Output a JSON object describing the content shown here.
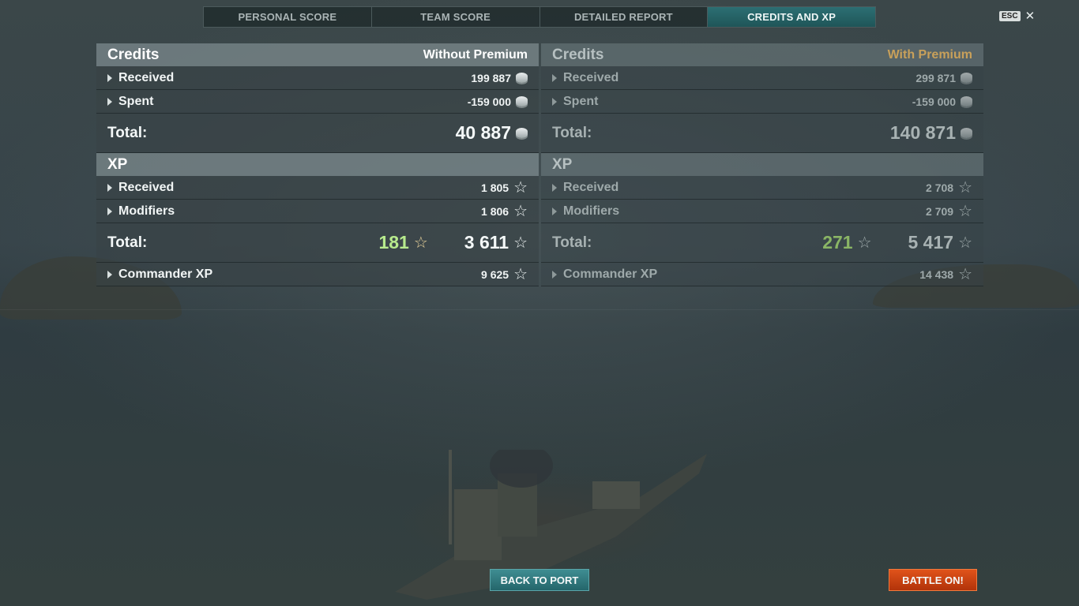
{
  "tabs": [
    {
      "label": "PERSONAL SCORE",
      "active": false
    },
    {
      "label": "TEAM SCORE",
      "active": false
    },
    {
      "label": "DETAILED REPORT",
      "active": false
    },
    {
      "label": "CREDITS AND XP",
      "active": true
    }
  ],
  "esc": {
    "key": "ESC",
    "close_icon": "close-icon"
  },
  "without_premium": {
    "credits": {
      "title": "Credits",
      "column_label": "Without Premium",
      "received": {
        "label": "Received",
        "value": "199 887"
      },
      "spent": {
        "label": "Spent",
        "value": "-159 000"
      },
      "total": {
        "label": "Total:",
        "value": "40 887"
      }
    },
    "xp": {
      "title": "XP",
      "received": {
        "label": "Received",
        "value": "1 805"
      },
      "modifiers": {
        "label": "Modifiers",
        "value": "1 806"
      },
      "total": {
        "label": "Total:",
        "free_xp": "181",
        "value": "3 611"
      },
      "commander": {
        "label": "Commander XP",
        "value": "9 625"
      }
    }
  },
  "with_premium": {
    "credits": {
      "title": "Credits",
      "column_label": "With Premium",
      "received": {
        "label": "Received",
        "value": "299 871"
      },
      "spent": {
        "label": "Spent",
        "value": "-159 000"
      },
      "total": {
        "label": "Total:",
        "value": "140 871"
      }
    },
    "xp": {
      "title": "XP",
      "received": {
        "label": "Received",
        "value": "2 708"
      },
      "modifiers": {
        "label": "Modifiers",
        "value": "2 709"
      },
      "total": {
        "label": "Total:",
        "free_xp": "271",
        "value": "5 417"
      },
      "commander": {
        "label": "Commander XP",
        "value": "14 438"
      }
    }
  },
  "buttons": {
    "back_to_port": "BACK TO PORT",
    "battle_on": "BATTLE ON!"
  },
  "colors": {
    "active_tab": "#2c6f73",
    "premium_label": "#c8a05a",
    "free_xp": "#b7ea8d",
    "battle_button": "#e0531a",
    "port_button": "#3f8d92"
  }
}
